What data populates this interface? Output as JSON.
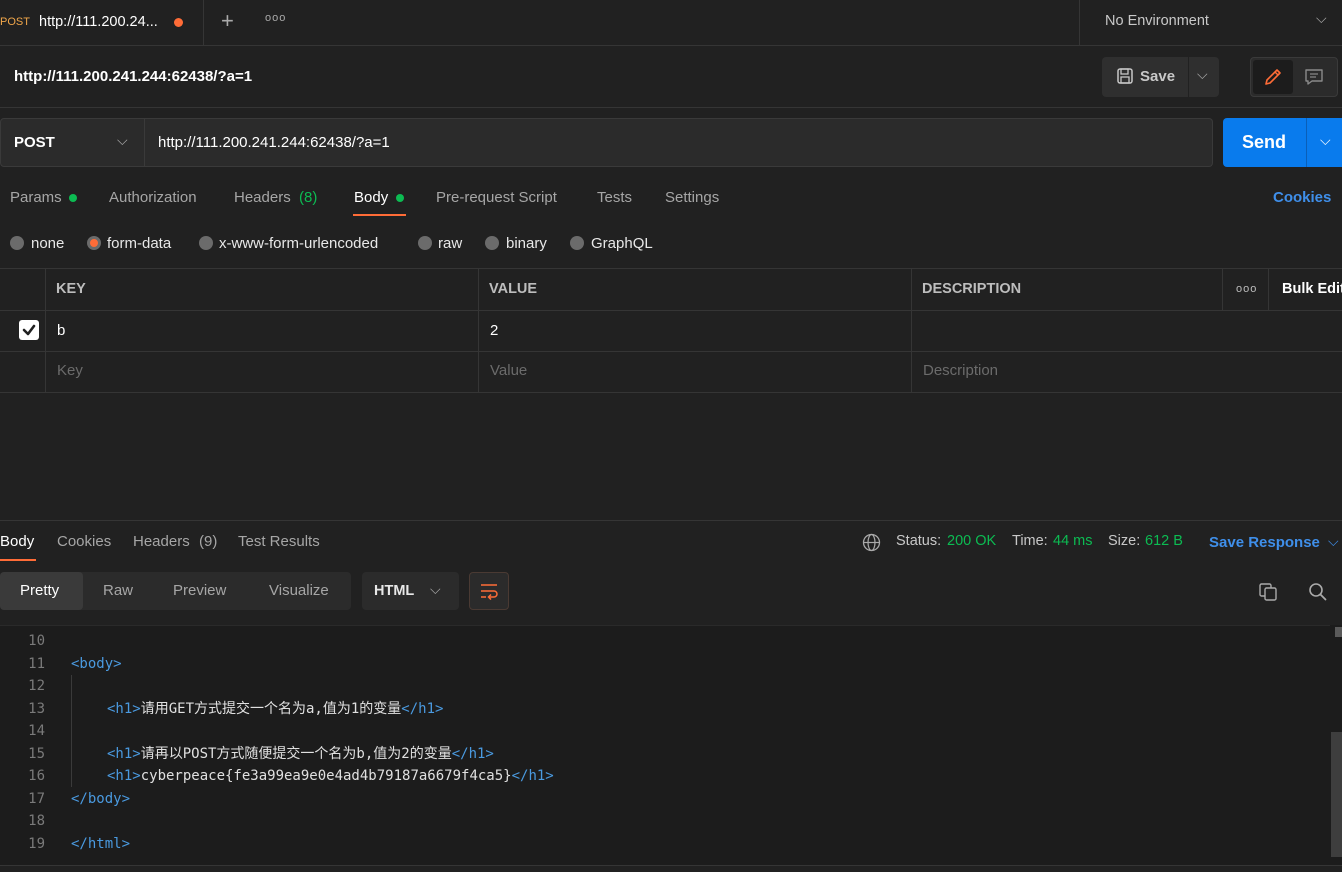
{
  "tab": {
    "method": "POST",
    "title": "http://111.200.24...",
    "plus": "+",
    "more": "ooo"
  },
  "environment": {
    "label": "No Environment"
  },
  "request": {
    "title": "http://111.200.241.244:62438/?a=1",
    "method": "POST",
    "url": "http://111.200.241.244:62438/?a=1",
    "save_label": "Save",
    "send_label": "Send"
  },
  "request_tabs": {
    "params": "Params",
    "authorization": "Authorization",
    "headers": "Headers",
    "headers_count": "(8)",
    "body": "Body",
    "pre_request": "Pre-request Script",
    "tests": "Tests",
    "settings": "Settings",
    "cookies": "Cookies"
  },
  "body_types": {
    "none": "none",
    "form_data": "form-data",
    "urlencoded": "x-www-form-urlencoded",
    "raw": "raw",
    "binary": "binary",
    "graphql": "GraphQL",
    "selected": "form-data"
  },
  "kv_table": {
    "headers": {
      "key": "KEY",
      "value": "VALUE",
      "description": "DESCRIPTION",
      "more": "ooo",
      "bulk_edit": "Bulk Edit"
    },
    "rows": [
      {
        "key": "b",
        "value": "2",
        "description": "",
        "checked": true
      }
    ],
    "placeholders": {
      "key": "Key",
      "value": "Value",
      "description": "Description"
    }
  },
  "response": {
    "tabs": {
      "body": "Body",
      "cookies": "Cookies",
      "headers": "Headers",
      "headers_count": "(9)",
      "test_results": "Test Results"
    },
    "status_label": "Status:",
    "status_value": "200 OK",
    "time_label": "Time:",
    "time_value": "44 ms",
    "size_label": "Size:",
    "size_value": "612 B",
    "save_response": "Save Response",
    "view_modes": {
      "pretty": "Pretty",
      "raw": "Raw",
      "preview": "Preview",
      "visualize": "Visualize"
    },
    "language": "HTML"
  },
  "code_lines": [
    {
      "n": "10",
      "open": "",
      "text": "",
      "close": "",
      "indent": 0
    },
    {
      "n": "11",
      "open": "<body>",
      "text": "",
      "close": "",
      "indent": 0
    },
    {
      "n": "12",
      "open": "",
      "text": "",
      "close": "",
      "indent": 0
    },
    {
      "n": "13",
      "open": "<h1>",
      "text": "请用GET方式提交一个名为a,值为1的变量",
      "close": "</h1>",
      "indent": 1
    },
    {
      "n": "14",
      "open": "",
      "text": "",
      "close": "",
      "indent": 0
    },
    {
      "n": "15",
      "open": "<h1>",
      "text": "请再以POST方式随便提交一个名为b,值为2的变量",
      "close": "</h1>",
      "indent": 1
    },
    {
      "n": "16",
      "open": "<h1>",
      "text": "cyberpeace{fe3a99ea9e0e4ad4b79187a6679f4ca5}",
      "close": "</h1>",
      "indent": 1
    },
    {
      "n": "17",
      "open": "</body>",
      "text": "",
      "close": "",
      "indent": 0
    },
    {
      "n": "18",
      "open": "",
      "text": "",
      "close": "",
      "indent": 0
    },
    {
      "n": "19",
      "open": "</html>",
      "text": "",
      "close": "",
      "indent": 0
    }
  ],
  "colors": {
    "accent": "#ff6c37",
    "send": "#097bed",
    "success": "#0cbb52",
    "link": "#3f8fea"
  }
}
